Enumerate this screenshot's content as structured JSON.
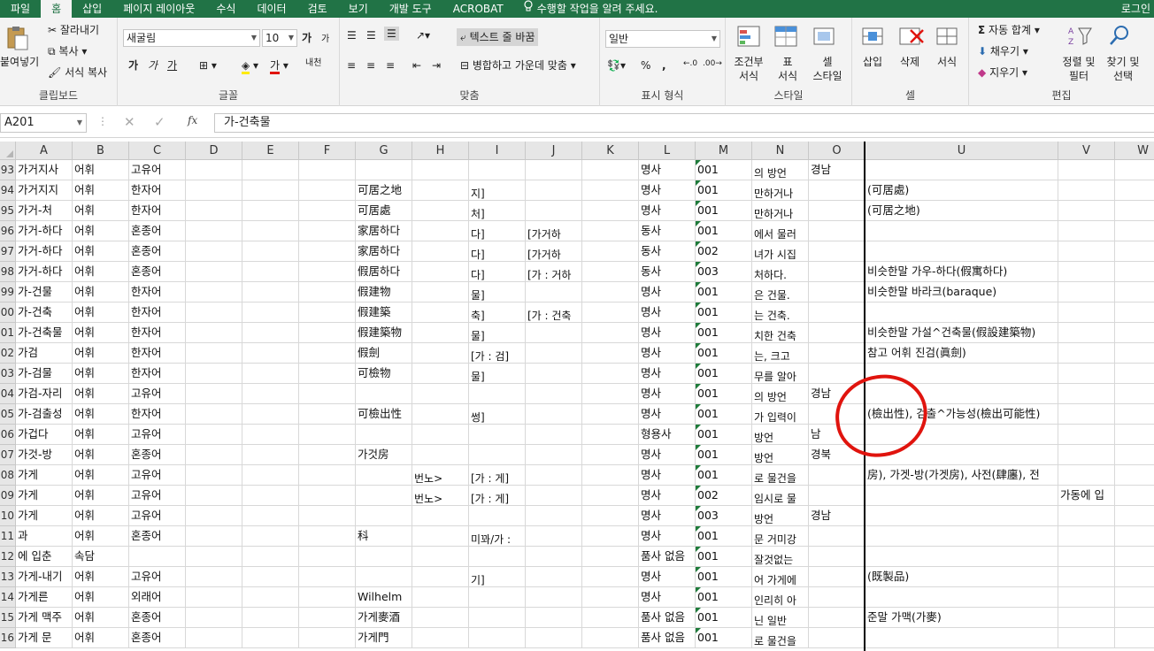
{
  "menu": {
    "tabs": [
      "파일",
      "홈",
      "삽입",
      "페이지 레이아웃",
      "수식",
      "데이터",
      "검토",
      "보기",
      "개발 도구",
      "ACROBAT"
    ],
    "active_index": 1,
    "tell_me": "수행할 작업을 알려 주세요.",
    "login": "로그인"
  },
  "ribbon": {
    "clipboard": {
      "paste": "붙여넣기",
      "cut": "잘라내기",
      "copy": "복사",
      "format_painter": "서식 복사",
      "label": "클립보드"
    },
    "font": {
      "name": "새굴림",
      "size": "10",
      "label": "글꼴",
      "bold": "가",
      "italic": "가",
      "underline": "가",
      "grow": "가",
      "shrink": "가",
      "font_color_char": "가",
      "phonetic": "내천"
    },
    "alignment": {
      "wrap_text": "텍스트 줄 바꿈",
      "merge_center": "병합하고 가운데 맞춤",
      "label": "맞춤"
    },
    "number": {
      "format": "일반",
      "label": "표시 형식"
    },
    "styles": {
      "conditional": "조건부\n서식",
      "conditional_1": "조건부",
      "conditional_2": "서식",
      "table_1": "표",
      "table_2": "서식",
      "cell_1": "셀",
      "cell_2": "스타일",
      "label": "스타일"
    },
    "cells": {
      "insert": "삽입",
      "delete": "삭제",
      "format": "서식",
      "label": "셀"
    },
    "editing": {
      "autosum": "자동 합계",
      "fill": "채우기",
      "clear": "지우기",
      "sort_1": "정렬 및",
      "sort_2": "필터",
      "find_1": "찾기 및",
      "find_2": "선택",
      "label": "편집"
    }
  },
  "formula_bar": {
    "name_box": "A201",
    "formula": "가-건축물"
  },
  "columns": [
    "A",
    "B",
    "C",
    "D",
    "E",
    "F",
    "G",
    "H",
    "I",
    "J",
    "K",
    "L",
    "M",
    "N",
    "O",
    "U",
    "V",
    "W"
  ],
  "rows": [
    {
      "num": "93",
      "A": "가거지사",
      "B": "어휘",
      "C": "고유어",
      "G": "",
      "H": "",
      "I": "",
      "J": "",
      "L": "명사",
      "M": "001",
      "N": "의 방언",
      "O": "경남",
      "U": "",
      "V": ""
    },
    {
      "num": "94",
      "A": "가거지지",
      "B": "어휘",
      "C": "한자어",
      "G": "可居之地",
      "H": "",
      "I": "지]",
      "J": "",
      "L": "명사",
      "M": "001",
      "N": "만하거나",
      "O": "",
      "U": "(可居處)",
      "V": ""
    },
    {
      "num": "95",
      "A": "가거-처",
      "B": "어휘",
      "C": "한자어",
      "G": "可居處",
      "H": "",
      "I": "처]",
      "J": "",
      "L": "명사",
      "M": "001",
      "N": "만하거나",
      "O": "",
      "U": "(可居之地)",
      "V": ""
    },
    {
      "num": "96",
      "A": "가거-하다",
      "B": "어휘",
      "C": "혼종어",
      "G": "家居하다",
      "H": "",
      "I": "다]",
      "J": "[가거하",
      "L": "동사",
      "M": "001",
      "N": "에서 물러",
      "O": "",
      "U": "",
      "V": ""
    },
    {
      "num": "97",
      "A": "가거-하다",
      "B": "어휘",
      "C": "혼종어",
      "G": "家居하다",
      "H": "",
      "I": "다]",
      "J": "[가거하",
      "L": "동사",
      "M": "002",
      "N": "녀가 시집",
      "O": "",
      "U": "",
      "V": ""
    },
    {
      "num": "98",
      "A": "가거-하다",
      "B": "어휘",
      "C": "혼종어",
      "G": "假居하다",
      "H": "",
      "I": "다]",
      "J": "[가 : 거하",
      "L": "동사",
      "M": "003",
      "N": "처하다.",
      "O": "",
      "U": "비슷한말 가우-하다(假寓하다)",
      "V": ""
    },
    {
      "num": "99",
      "A": "가-건물",
      "B": "어휘",
      "C": "한자어",
      "G": "假建物",
      "H": "",
      "I": "물]",
      "J": "",
      "L": "명사",
      "M": "001",
      "N": "은 건물.",
      "O": "",
      "U": "비슷한말 바라크(baraque)",
      "V": ""
    },
    {
      "num": "00",
      "A": "가-건축",
      "B": "어휘",
      "C": "한자어",
      "G": "假建築",
      "H": "",
      "I": "축]",
      "J": "[가 : 건축",
      "L": "명사",
      "M": "001",
      "N": "는 건축.",
      "O": "",
      "U": "",
      "V": ""
    },
    {
      "num": "01",
      "A": "가-건축물",
      "B": "어휘",
      "C": "한자어",
      "G": "假建築物",
      "H": "",
      "I": "물]",
      "J": "",
      "L": "명사",
      "M": "001",
      "N": "치한 건축",
      "O": "",
      "U": "비슷한말 가설^건축물(假設建築物)",
      "V": ""
    },
    {
      "num": "02",
      "A": "가검",
      "B": "어휘",
      "C": "한자어",
      "G": "假劍",
      "H": "",
      "I": "[가 : 검]",
      "J": "",
      "L": "명사",
      "M": "001",
      "N": "는, 크고",
      "O": "",
      "U": "참고 어휘 진검(眞劍)",
      "V": ""
    },
    {
      "num": "03",
      "A": "가-검물",
      "B": "어휘",
      "C": "한자어",
      "G": "可檢物",
      "H": "",
      "I": "물]",
      "J": "",
      "L": "명사",
      "M": "001",
      "N": "무를 알아",
      "O": "",
      "U": "",
      "V": ""
    },
    {
      "num": "04",
      "A": "가검-자리",
      "B": "어휘",
      "C": "고유어",
      "G": "",
      "H": "",
      "I": "",
      "J": "",
      "L": "명사",
      "M": "001",
      "N": "의 방언",
      "O": "경남",
      "U": "",
      "V": ""
    },
    {
      "num": "05",
      "A": "가-검출성",
      "B": "어휘",
      "C": "한자어",
      "G": "可檢出性",
      "H": "",
      "I": "썽]",
      "J": "",
      "L": "명사",
      "M": "001",
      "N": "가 입력이",
      "O": "",
      "U": "(檢出性), 검출^가능성(檢出可能性)",
      "V": ""
    },
    {
      "num": "06",
      "A": "가겁다",
      "B": "어휘",
      "C": "고유어",
      "G": "",
      "H": "",
      "I": "",
      "J": "",
      "L": "형용사",
      "M": "001",
      "N": "방언",
      "O": "남",
      "U": "",
      "V": ""
    },
    {
      "num": "07",
      "A": "가것-방",
      "B": "어휘",
      "C": "혼종어",
      "G": "가것房",
      "H": "",
      "I": "",
      "J": "",
      "L": "명사",
      "M": "001",
      "N": "방언",
      "O": "경북",
      "U": "",
      "V": ""
    },
    {
      "num": "08",
      "A": "가게",
      "B": "어휘",
      "C": "고유어",
      "G": "",
      "H": "번노>",
      "I": "[가 : 게]",
      "J": "",
      "L": "명사",
      "M": "001",
      "N": "로 물건을",
      "O": "",
      "U": "房), 가겟-방(가겟房), 사전(肆廛), 전",
      "V": ""
    },
    {
      "num": "09",
      "A": "가게",
      "B": "어휘",
      "C": "고유어",
      "G": "",
      "H": "번노>",
      "I": "[가 : 게]",
      "J": "",
      "L": "명사",
      "M": "002",
      "N": "임시로 물",
      "O": "",
      "U": "",
      "V": "가동에 입"
    },
    {
      "num": "10",
      "A": "가게",
      "B": "어휘",
      "C": "고유어",
      "G": "",
      "H": "",
      "I": "",
      "J": "",
      "L": "명사",
      "M": "003",
      "N": "방언",
      "O": "경남",
      "U": "",
      "V": ""
    },
    {
      "num": "11",
      "A": "과",
      "B": "어휘",
      "C": "혼종어",
      "G": "科",
      "H": "",
      "I": "미꽈/가 :",
      "J": "",
      "L": "명사",
      "M": "001",
      "N": "문 거미강",
      "O": "",
      "U": "",
      "V": ""
    },
    {
      "num": "12",
      "A": "에 입춘",
      "B": "속담",
      "C": "",
      "G": "",
      "H": "",
      "I": "",
      "J": "",
      "L": "품사 없음",
      "M": "001",
      "N": "잘것없는",
      "O": "",
      "U": "",
      "V": ""
    },
    {
      "num": "13",
      "A": "가게-내기",
      "B": "어휘",
      "C": "고유어",
      "G": "",
      "H": "",
      "I": "기]",
      "J": "",
      "L": "명사",
      "M": "001",
      "N": "어 가게에",
      "O": "",
      "U": "(既製品)",
      "V": ""
    },
    {
      "num": "14",
      "A": "가게른",
      "B": "어휘",
      "C": "외래어",
      "G": "Wilhelm",
      "H": "",
      "I": "",
      "J": "",
      "L": "명사",
      "M": "001",
      "N": "인리히 아",
      "O": "",
      "U": "",
      "V": ""
    },
    {
      "num": "15",
      "A": "가게 맥주",
      "B": "어휘",
      "C": "혼종어",
      "G": "가게麥酒",
      "H": "",
      "I": "",
      "J": "",
      "L": "품사 없음",
      "M": "001",
      "N": "닌 일반",
      "O": "",
      "U": "준말 가맥(가麥)",
      "V": ""
    },
    {
      "num": "16",
      "A": "가게 문",
      "B": "어휘",
      "C": "혼종어",
      "G": "가게門",
      "H": "",
      "I": "",
      "J": "",
      "L": "품사 없음",
      "M": "001",
      "N": "로 물건을",
      "O": "",
      "U": "",
      "V": ""
    }
  ]
}
